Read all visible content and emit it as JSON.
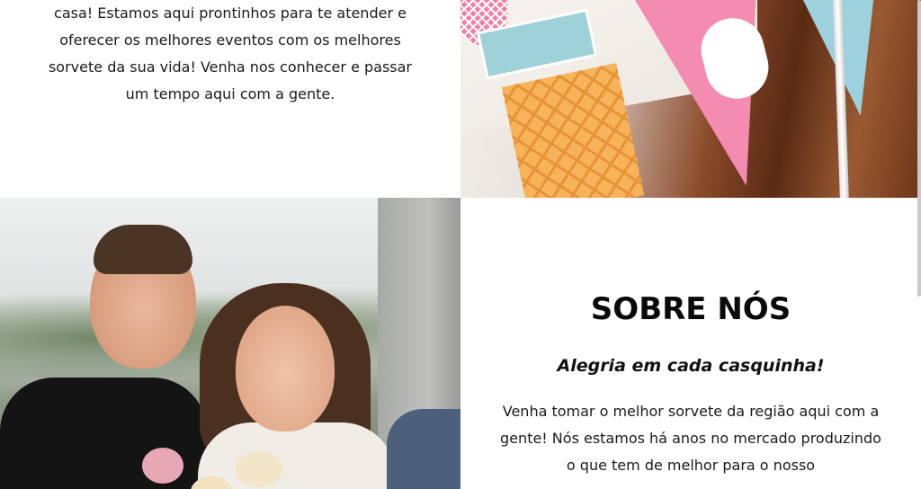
{
  "top_left": {
    "intro_text": "casa! Estamos aqui prontinhos para te atender e\noferecer os melhores eventos com os melhores\nsorvete da sua vida! Venha nos conhecer e passar\num tempo aqui com a gente."
  },
  "images": {
    "party_image": "party-decoration-image",
    "people_image": "friends-ice-cream-image"
  },
  "about": {
    "title": "SOBRE NÓS",
    "subtitle": "Alegria em cada casquinha!",
    "text": "Venha tomar o melhor sorvete da região aqui com a gente! Nós estamos há anos no mercado produzindo o que tem de melhor para o nosso"
  },
  "colors": {
    "background": "#ffffff",
    "text": "#111111"
  }
}
